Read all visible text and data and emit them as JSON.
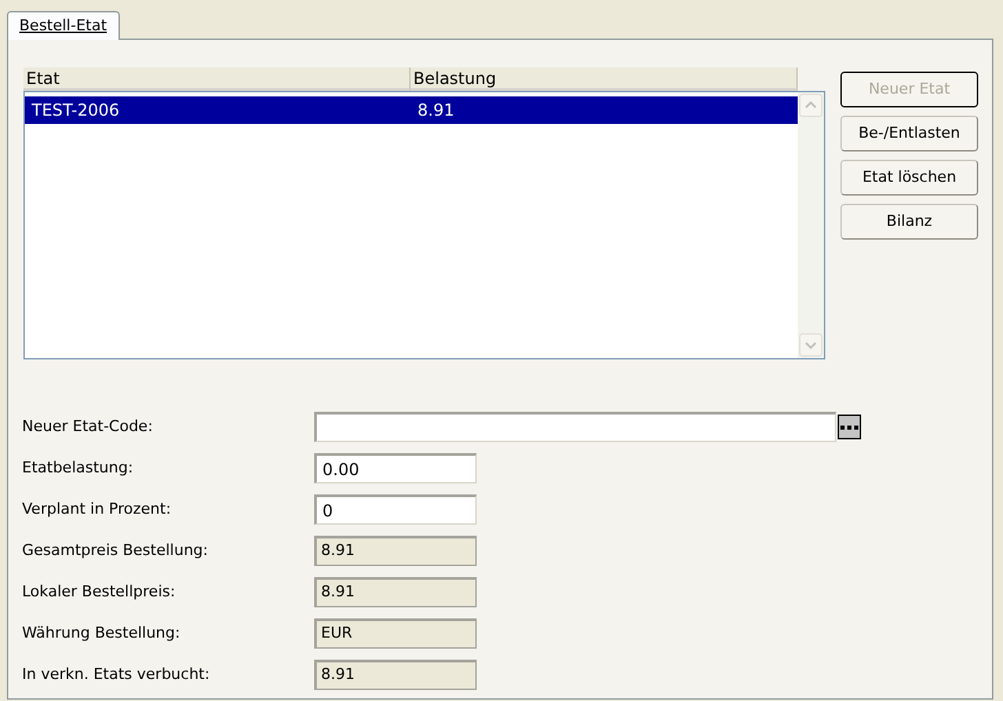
{
  "tabs": [
    {
      "label": "Bestell-Etat",
      "selected": true
    }
  ],
  "table": {
    "columns": [
      "Etat",
      "Belastung"
    ],
    "rows": [
      {
        "cells": [
          "TEST-2006",
          "8.91"
        ],
        "selected": true
      }
    ]
  },
  "buttons": [
    {
      "label": "Neuer Etat",
      "disabled": true
    },
    {
      "label": "Be-/Entlasten",
      "disabled": false
    },
    {
      "label": "Etat löschen",
      "disabled": false
    },
    {
      "label": "Bilanz",
      "disabled": false
    }
  ],
  "fields": [
    {
      "label": "Neuer Etat-Code:",
      "kind": "browse"
    },
    {
      "label": "Etatbelastung:",
      "kind": "input",
      "value": "0.00"
    },
    {
      "label": "Verplant in Prozent:",
      "kind": "input",
      "value": "0"
    },
    {
      "label": "Gesamtpreis Bestellung:",
      "kind": "readonly",
      "value": "8.91"
    },
    {
      "label": "Lokaler Bestellpreis:",
      "kind": "readonly",
      "value": "8.91"
    },
    {
      "label": "Währung Bestellung:",
      "kind": "readonly",
      "value": "EUR"
    },
    {
      "label": "In verkn. Etats verbucht:",
      "kind": "readonly",
      "value": "8.91"
    }
  ]
}
